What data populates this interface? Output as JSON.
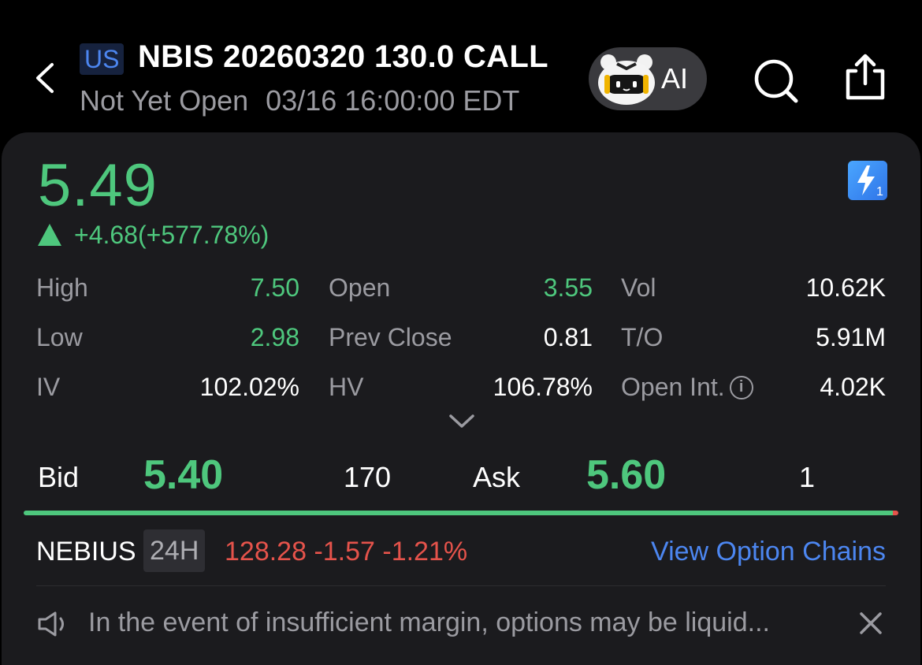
{
  "header": {
    "market": "US",
    "title": "NBIS 20260320 130.0 CALL",
    "status": "Not Yet Open",
    "datetime": "03/16 16:00:00 EDT",
    "ai_label": "AI"
  },
  "quote": {
    "price": "5.49",
    "change": "+4.68(+577.78%)",
    "direction": "up",
    "flash_badge": "1"
  },
  "stats": {
    "high": {
      "label": "High",
      "value": "7.50"
    },
    "open": {
      "label": "Open",
      "value": "3.55"
    },
    "vol": {
      "label": "Vol",
      "value": "10.62K"
    },
    "low": {
      "label": "Low",
      "value": "2.98"
    },
    "prev_close": {
      "label": "Prev Close",
      "value": "0.81"
    },
    "turnover": {
      "label": "T/O",
      "value": "5.91M"
    },
    "iv": {
      "label": "IV",
      "value": "102.02%"
    },
    "hv": {
      "label": "HV",
      "value": "106.78%"
    },
    "open_int": {
      "label": "Open Int.",
      "value": "4.02K"
    }
  },
  "bidask": {
    "bid_label": "Bid",
    "bid_price": "5.40",
    "bid_size": "170",
    "ask_label": "Ask",
    "ask_price": "5.60",
    "ask_size": "1",
    "bid_fraction": 0.994
  },
  "underlying": {
    "name": "NEBIUS",
    "session": "24H",
    "quote": "128.28 -1.57 -1.21%",
    "link": "View Option Chains"
  },
  "notice": {
    "text": "In the event of insufficient margin, options may be liquid..."
  },
  "colors": {
    "up": "#4ec77d",
    "down": "#e5534b",
    "accent": "#4c86f0",
    "muted": "#9b9ba1",
    "card_bg": "#1b1b1e"
  }
}
